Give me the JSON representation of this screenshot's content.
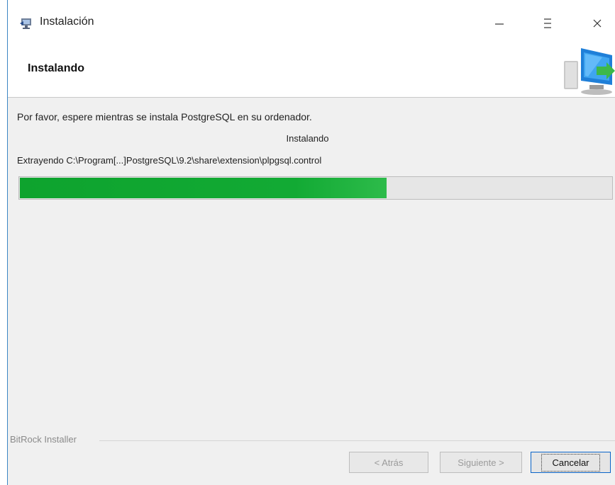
{
  "window": {
    "title": "Instalación",
    "icons": {
      "app": "installer-icon",
      "minimize": "minimize-icon",
      "maximize": "maximize-icon",
      "close": "close-icon"
    }
  },
  "header": {
    "title": "Instalando",
    "logo": "computer-install-logo"
  },
  "body": {
    "intro": "Por favor, espere mientras se instala PostgreSQL en su ordenador.",
    "status": "Instalando",
    "extract": "Extrayendo C:\\Program[...]PostgreSQL\\9.2\\share\\extension\\plpgsql.control",
    "progress": 0.62
  },
  "footer": {
    "brand": "BitRock Installer",
    "back_label": "< Atrás",
    "next_label": "Siguiente >",
    "cancel_label": "Cancelar"
  },
  "colors": {
    "progress": "#12aa34",
    "accent": "#0a64c8"
  }
}
